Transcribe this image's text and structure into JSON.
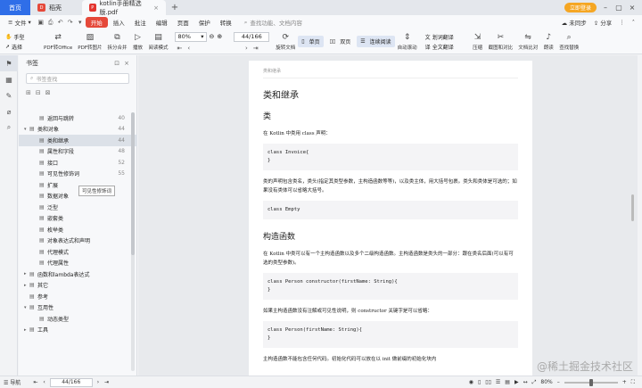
{
  "tabs": {
    "home": "首页",
    "t1": "稻壳",
    "t2": "kotlin手册精选版.pdf",
    "login": "立即登录",
    "pdf_icon": "P"
  },
  "menu": {
    "file": "文件",
    "items": [
      "开始",
      "插入",
      "批注",
      "编辑",
      "页面",
      "保护",
      "转换"
    ],
    "search": "查找功能、文档内容",
    "right": [
      "未同步",
      "分享"
    ]
  },
  "ribbon": {
    "hand": "手型",
    "select": "选择",
    "pdf_office": "PDF转Office",
    "pdf_image": "PDF转图片",
    "split": "拆分合并",
    "play": "播放",
    "read": "阅读模式",
    "zoom": "80%",
    "page": "44/166",
    "rotate": "旋转文档",
    "single": "单页",
    "double": "双页",
    "continuous": "连续阅读",
    "auto_scroll": "自动滚动",
    "translate_word": "划词翻译",
    "translate_full": "全文翻译",
    "screenshot": "截图对比",
    "compress": "压缩",
    "ocr": "截图和对比",
    "dict": "文档比对",
    "read_aloud": "朗读",
    "find": "查找替换"
  },
  "panel": {
    "title": "书签",
    "search_placeholder": "书签查找",
    "tooltip": "可见性修饰词",
    "bookmarks": [
      {
        "label": "返回与跳转",
        "page": "40",
        "level": 1,
        "expand": ""
      },
      {
        "label": "类和对象",
        "page": "44",
        "level": 0,
        "expand": "▾"
      },
      {
        "label": "类和继承",
        "page": "44",
        "level": 1,
        "expand": "",
        "hl": true
      },
      {
        "label": "属性和字段",
        "page": "48",
        "level": 1,
        "expand": ""
      },
      {
        "label": "接口",
        "page": "52",
        "level": 1,
        "expand": ""
      },
      {
        "label": "可见性修饰词",
        "page": "55",
        "level": 1,
        "expand": ""
      },
      {
        "label": "扩展",
        "page": "",
        "level": 1,
        "expand": ""
      },
      {
        "label": "数据对象",
        "page": "",
        "level": 1,
        "expand": ""
      },
      {
        "label": "泛型",
        "page": "",
        "level": 1,
        "expand": ""
      },
      {
        "label": "嵌套类",
        "page": "",
        "level": 1,
        "expand": ""
      },
      {
        "label": "枚举类",
        "page": "",
        "level": 1,
        "expand": ""
      },
      {
        "label": "对象表达式和声明",
        "page": "",
        "level": 1,
        "expand": ""
      },
      {
        "label": "代理模式",
        "page": "",
        "level": 1,
        "expand": ""
      },
      {
        "label": "代理属性",
        "page": "",
        "level": 1,
        "expand": ""
      },
      {
        "label": "函数和lambda表达式",
        "page": "",
        "level": 0,
        "expand": "▸"
      },
      {
        "label": "其它",
        "page": "",
        "level": 0,
        "expand": "▸"
      },
      {
        "label": "参考",
        "page": "",
        "level": 0,
        "expand": ""
      },
      {
        "label": "互用性",
        "page": "",
        "level": 0,
        "expand": "▾"
      },
      {
        "label": "动态类型",
        "page": "",
        "level": 1,
        "expand": ""
      },
      {
        "label": "工具",
        "page": "",
        "level": 0,
        "expand": "▸"
      }
    ]
  },
  "document": {
    "running_head": "类和继承",
    "h1": "类和继承",
    "h2a": "类",
    "p1": "在 Kotlin 中类用 class 声明：",
    "code1": "class Invoice{\n}",
    "p2": "类的声明包含类名，类头(指定其类型参数，主构造函数等等)，以及类主体，用大括号包裹。类头和类体是可选的；如果没有类体可以省略大括号。",
    "code2": "class Empty",
    "h2b": "构造函数",
    "p3": "在 Kotlin 中类可以有一个主构造函数以及多个二级构造函数。主构造函数是类头的一部分：跟在类名后面(可以有可选的类型参数)。",
    "code3": "class Person constructor(firstName: String){\n}",
    "p4": "如果主构造函数没有注解或可见性说明，则 constructor 关键字是可以省略：",
    "code4": "class Person(firstName: String){\n}",
    "p5": "主构造函数不能包含任何代码。初始化代码可以放在以 init 做前缀的初始化块内"
  },
  "status": {
    "nav": "导航",
    "page": "44/166",
    "zoom": "80%"
  },
  "watermark": "@稀土掘金技术社区"
}
